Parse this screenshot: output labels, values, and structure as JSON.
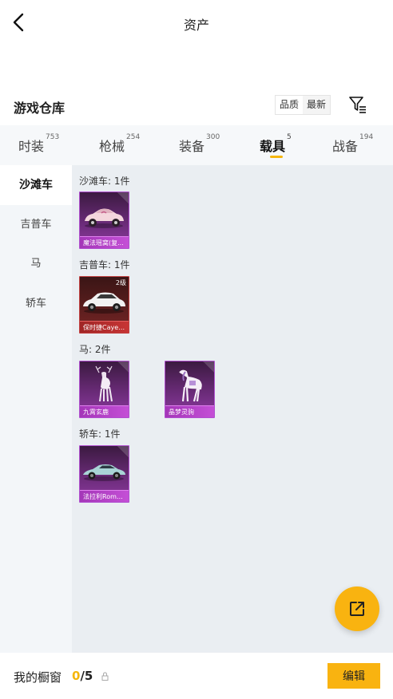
{
  "header": {
    "title": "资产",
    "back_icon": "chevron-left-icon"
  },
  "warehouse": {
    "title": "游戏仓库",
    "sort_options": [
      "品质",
      "最新"
    ],
    "sort_selected": "品质",
    "filter_icon": "filter-icon"
  },
  "tabs": [
    {
      "label": "时装",
      "count": "753"
    },
    {
      "label": "枪械",
      "count": "254"
    },
    {
      "label": "装备",
      "count": "300"
    },
    {
      "label": "载具",
      "count": "5",
      "active": true
    },
    {
      "label": "战备",
      "count": "194"
    }
  ],
  "sidebar": {
    "items": [
      {
        "label": "沙滩车",
        "active": true
      },
      {
        "label": "吉普车"
      },
      {
        "label": "马"
      },
      {
        "label": "轿车"
      }
    ]
  },
  "groups": [
    {
      "label": "沙滩车: 1件",
      "items": [
        {
          "name": "魔法瑶窝(复...",
          "rarity": "purple",
          "icon": "beach-buggy-icon"
        }
      ]
    },
    {
      "label": "吉普车: 1件",
      "items": [
        {
          "name": "保时捷Cayen...",
          "rarity": "red",
          "level": "2级",
          "icon": "suv-car-icon"
        }
      ]
    },
    {
      "label": "马: 2件",
      "items": [
        {
          "name": "九霄玄鹿",
          "rarity": "purple",
          "icon": "deer-icon"
        },
        {
          "name": "晶梦灵驹",
          "rarity": "purple",
          "icon": "horse-icon"
        }
      ]
    },
    {
      "label": "轿车: 1件",
      "items": [
        {
          "name": "法拉利Roma(...",
          "rarity": "purple",
          "icon": "sports-car-icon"
        }
      ]
    }
  ],
  "fab": {
    "icon": "share-external-icon"
  },
  "showcase": {
    "label": "我的橱窗",
    "current": "0",
    "separator": "/",
    "total": "5",
    "lock_icon": "lock-icon",
    "edit_label": "编辑"
  },
  "colors": {
    "accent": "#F9B310",
    "rarity_purple": "#A436B8",
    "rarity_red": "#A02525"
  }
}
